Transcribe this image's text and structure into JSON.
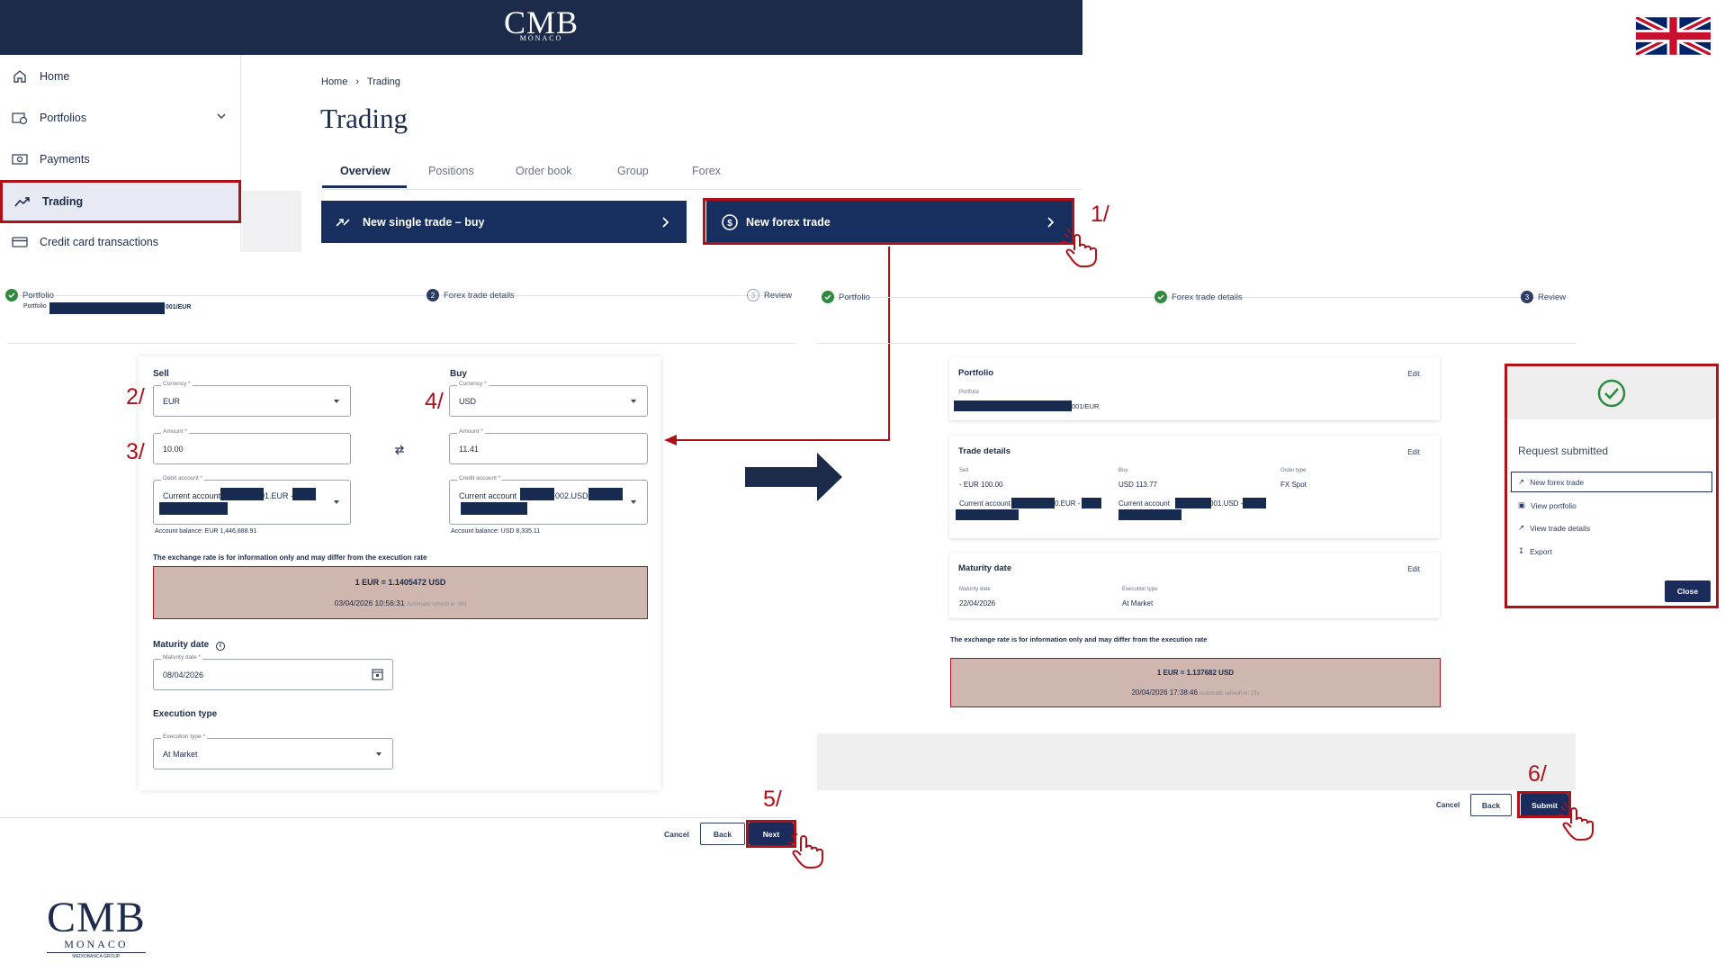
{
  "brand": {
    "name": "CMB",
    "sub": "MONACO",
    "group": "MEDIOBANCA GROUP"
  },
  "sidebar": {
    "items": [
      {
        "label": "Home",
        "icon": "home-icon"
      },
      {
        "label": "Portfolios",
        "icon": "portfolio-icon"
      },
      {
        "label": "Payments",
        "icon": "payments-icon"
      },
      {
        "label": "Trading",
        "icon": "trading-icon",
        "active": true
      },
      {
        "label": "Credit card transactions",
        "icon": "credit-card-icon"
      }
    ]
  },
  "breadcrumb": {
    "home": "Home",
    "current": "Trading"
  },
  "page_title": "Trading",
  "tabs": [
    "Overview",
    "Positions",
    "Order book",
    "Group",
    "Forex"
  ],
  "actions": {
    "single_trade": "New single trade – buy",
    "forex_trade": "New forex trade"
  },
  "steps": {
    "s1": "1/",
    "s2": "2/",
    "s3": "3/",
    "s4": "4/",
    "s5": "5/",
    "s6": "6/"
  },
  "left_stepper": {
    "step1": "Portfolio",
    "step1_sub": "Portfolio",
    "step1_account": "001/EUR",
    "step2": "Forex trade details",
    "step2_num": "2",
    "step3": "Review",
    "step3_num": "3"
  },
  "form": {
    "sell": {
      "title": "Sell",
      "currency_label": "Currency *",
      "currency": "EUR",
      "amount_label": "Amount *",
      "amount": "10.00",
      "account_label": "Debit account *",
      "account_prefix": "Current account",
      "account_mid": "01.EUR -",
      "balance": "Account balance: EUR 1,446,888.91"
    },
    "buy": {
      "title": "Buy",
      "currency_label": "Currency *",
      "currency": "USD",
      "amount_label": "Amount *",
      "amount": "11.41",
      "account_label": "Credit account *",
      "account_prefix": "Current account",
      "account_mid": "002.USD",
      "balance": "Account balance: USD 8,335.11"
    },
    "rate_notice": "The exchange rate is for information only and may differ from the execution rate",
    "rate": "1 EUR = 1.1405472 USD",
    "rate_time": "03/04/2026 10:56:31",
    "rate_refresh": "Automatic refresh in: 39s",
    "maturity_title": "Maturity date",
    "maturity_label": "Maturity date *",
    "maturity_value": "08/04/2026",
    "execution_title": "Execution type",
    "execution_label": "Execution type *",
    "execution_value": "At Market"
  },
  "left_buttons": {
    "cancel": "Cancel",
    "back": "Back",
    "next": "Next"
  },
  "right_stepper": {
    "step1": "Portfolio",
    "step2": "Forex trade details",
    "step3": "Review",
    "step3_num": "3"
  },
  "review": {
    "portfolio_title": "Portfolio",
    "edit": "Edit",
    "portfolio_label": "Portfolio",
    "portfolio_value": "001/EUR",
    "trade_title": "Trade details",
    "sell_label": "Sell",
    "sell_value": "- EUR 100.00",
    "buy_label": "Buy",
    "buy_value": "USD 113.77",
    "order_type_label": "Order type",
    "order_type_value": "FX Spot",
    "sell_account_prefix": "Current account",
    "sell_account_mid": "0.EUR -",
    "buy_account_prefix": "Current account",
    "buy_account_mid": "001.USD -",
    "maturity_title": "Maturity date",
    "maturity_label": "Maturity date",
    "maturity_value": "22/04/2026",
    "execution_label": "Execution type",
    "execution_value": "At Market",
    "rate_notice": "The exchange rate is for information only and may differ from the execution rate",
    "rate": "1 EUR = 1.137682 USD",
    "rate_time": "20/04/2026 17:38:46",
    "rate_refresh": "Automatic refresh in: 13s"
  },
  "right_buttons": {
    "cancel": "Cancel",
    "back": "Back",
    "submit": "Submit"
  },
  "modal": {
    "title": "Request submitted",
    "items": [
      "New forex trade",
      "View portfolio",
      "View trade details",
      "Export"
    ],
    "close": "Close"
  },
  "colors": {
    "navy": "#172f5e",
    "accent_red": "#b01119",
    "rate_bg": "#cfb6ae",
    "success": "#2e8b3e"
  }
}
